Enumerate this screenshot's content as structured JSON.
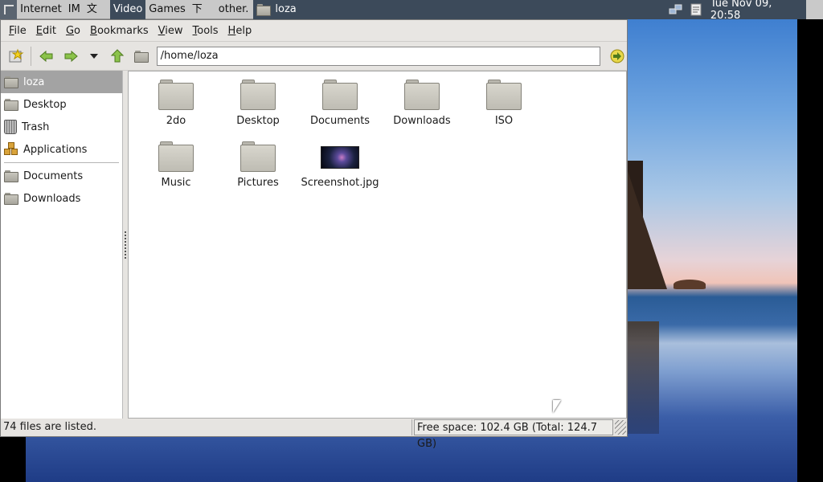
{
  "panel": {
    "menus": [
      "Internet",
      "IM",
      "文件",
      "Video",
      "Games",
      "下載",
      "other."
    ],
    "active_menu": "Video",
    "task": "loza",
    "clock": "Tue Nov 09, 20:58"
  },
  "window": {
    "menubar": [
      {
        "key": "F",
        "rest": "ile"
      },
      {
        "key": "E",
        "rest": "dit"
      },
      {
        "key": "G",
        "rest": "o"
      },
      {
        "key": "B",
        "rest": "ookmarks"
      },
      {
        "key": "V",
        "rest": "iew"
      },
      {
        "key": "T",
        "rest": "ools"
      },
      {
        "key": "H",
        "rest": "elp"
      }
    ],
    "location": "/home/loza",
    "sidebar": {
      "places": [
        "loza",
        "Desktop",
        "Trash",
        "Applications"
      ],
      "bookmarks": [
        "Documents",
        "Downloads"
      ]
    },
    "files": [
      {
        "name": "2do",
        "kind": "folder"
      },
      {
        "name": "Desktop",
        "kind": "folder"
      },
      {
        "name": "Documents",
        "kind": "folder"
      },
      {
        "name": "Downloads",
        "kind": "folder"
      },
      {
        "name": "ISO",
        "kind": "folder"
      },
      {
        "name": "Music",
        "kind": "folder"
      },
      {
        "name": "Pictures",
        "kind": "folder"
      },
      {
        "name": "Screenshot.jpg",
        "kind": "image"
      }
    ],
    "status": {
      "left": "74 files are listed.",
      "right": "Free space: 102.4 GB (Total: 124.7 GB)"
    }
  },
  "colors": {
    "panel_active": "#3c4a5a",
    "selection": "#a3a3a3"
  }
}
